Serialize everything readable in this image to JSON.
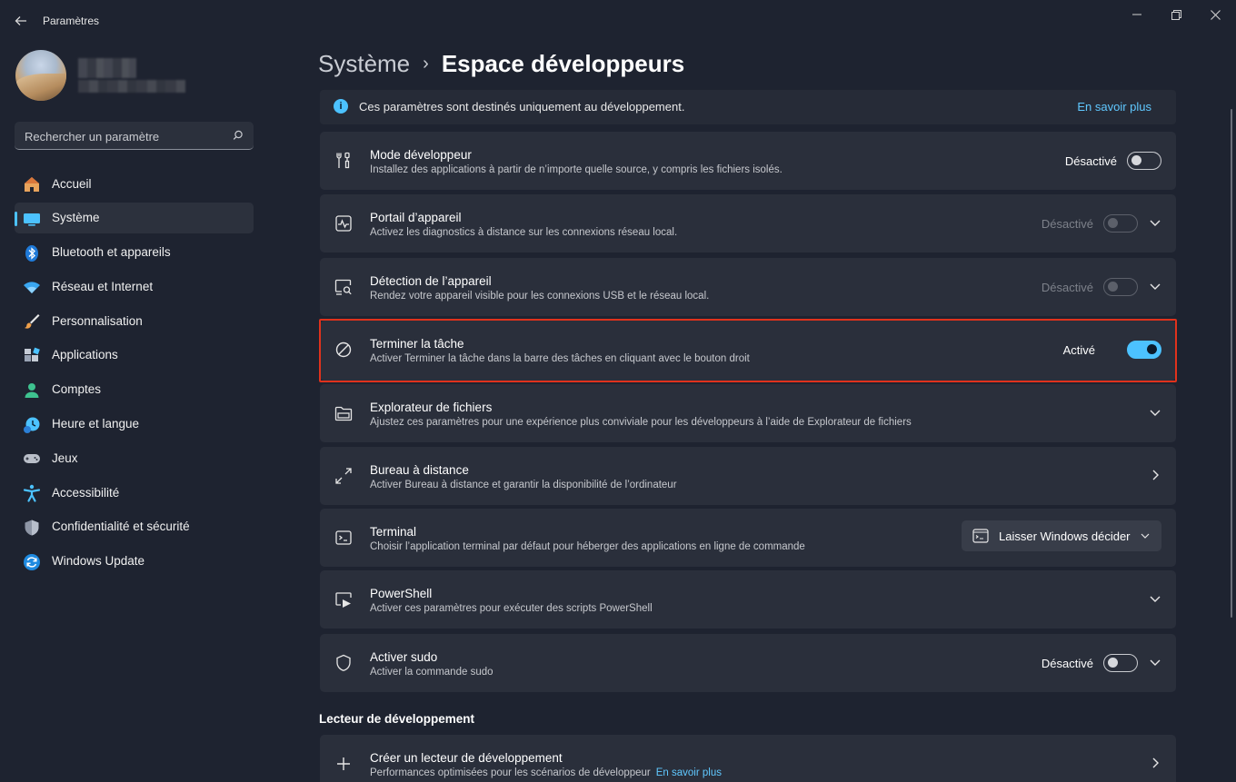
{
  "window": {
    "title": "Paramètres"
  },
  "sidebar": {
    "search_placeholder": "Rechercher un paramètre",
    "items": [
      {
        "label": "Accueil",
        "icon": "home-icon"
      },
      {
        "label": "Système",
        "icon": "system-icon",
        "active": true
      },
      {
        "label": "Bluetooth et appareils",
        "icon": "bluetooth-icon"
      },
      {
        "label": "Réseau et Internet",
        "icon": "wifi-icon"
      },
      {
        "label": "Personnalisation",
        "icon": "brush-icon"
      },
      {
        "label": "Applications",
        "icon": "apps-icon"
      },
      {
        "label": "Comptes",
        "icon": "account-icon"
      },
      {
        "label": "Heure et langue",
        "icon": "clock-icon"
      },
      {
        "label": "Jeux",
        "icon": "gamepad-icon"
      },
      {
        "label": "Accessibilité",
        "icon": "accessibility-icon"
      },
      {
        "label": "Confidentialité et sécurité",
        "icon": "shield-icon"
      },
      {
        "label": "Windows Update",
        "icon": "update-icon"
      }
    ]
  },
  "breadcrumb": {
    "parent": "Système",
    "current": "Espace développeurs"
  },
  "info": {
    "text": "Ces paramètres sont destinés uniquement au développement.",
    "link": "En savoir plus"
  },
  "cards": [
    {
      "title": "Mode développeur",
      "subtitle": "Installez des applications à partir de n’importe quelle source, y compris les fichiers isolés.",
      "state": "Désactivé",
      "icon": "tools-icon"
    },
    {
      "title": "Portail d’appareil",
      "subtitle": "Activez les diagnostics à distance sur les connexions réseau local.",
      "state": "Désactivé",
      "icon": "pulse-icon"
    },
    {
      "title": "Détection de l’appareil",
      "subtitle": "Rendez votre appareil visible pour les connexions USB et le réseau local.",
      "state": "Désactivé",
      "icon": "device-search-icon"
    },
    {
      "title": "Terminer la tâche",
      "subtitle": "Activer Terminer la tâche dans la barre des tâches en cliquant avec le bouton droit",
      "state": "Activé",
      "icon": "prohibited-icon"
    },
    {
      "title": "Explorateur de fichiers",
      "subtitle": "Ajustez ces paramètres pour une expérience plus conviviale pour les développeurs à l’aide de Explorateur de fichiers",
      "icon": "folder-icon"
    },
    {
      "title": "Bureau à distance",
      "subtitle": "Activer Bureau à distance et garantir la disponibilité de l’ordinateur",
      "icon": "remote-icon"
    },
    {
      "title": "Terminal",
      "subtitle": "Choisir l’application terminal par défaut pour héberger des applications en ligne de commande",
      "dropdown": "Laisser Windows décider",
      "icon": "terminal-icon"
    },
    {
      "title": "PowerShell",
      "subtitle": "Activer ces paramètres pour exécuter des scripts PowerShell",
      "icon": "powershell-icon"
    },
    {
      "title": "Activer sudo",
      "subtitle": "Activer la commande sudo",
      "state": "Désactivé",
      "icon": "shield-outline-icon"
    }
  ],
  "section": {
    "title": "Lecteur de développement"
  },
  "dev_drive": {
    "title": "Créer un lecteur de développement",
    "subtitle": "Performances optimisées pour les scénarios de développeur",
    "link": "En savoir plus",
    "icon": "plus-icon"
  },
  "colors": {
    "accent": "#4cc2ff",
    "highlight": "#e0321c",
    "background": "#1e2330",
    "card": "#2a2f3b"
  }
}
